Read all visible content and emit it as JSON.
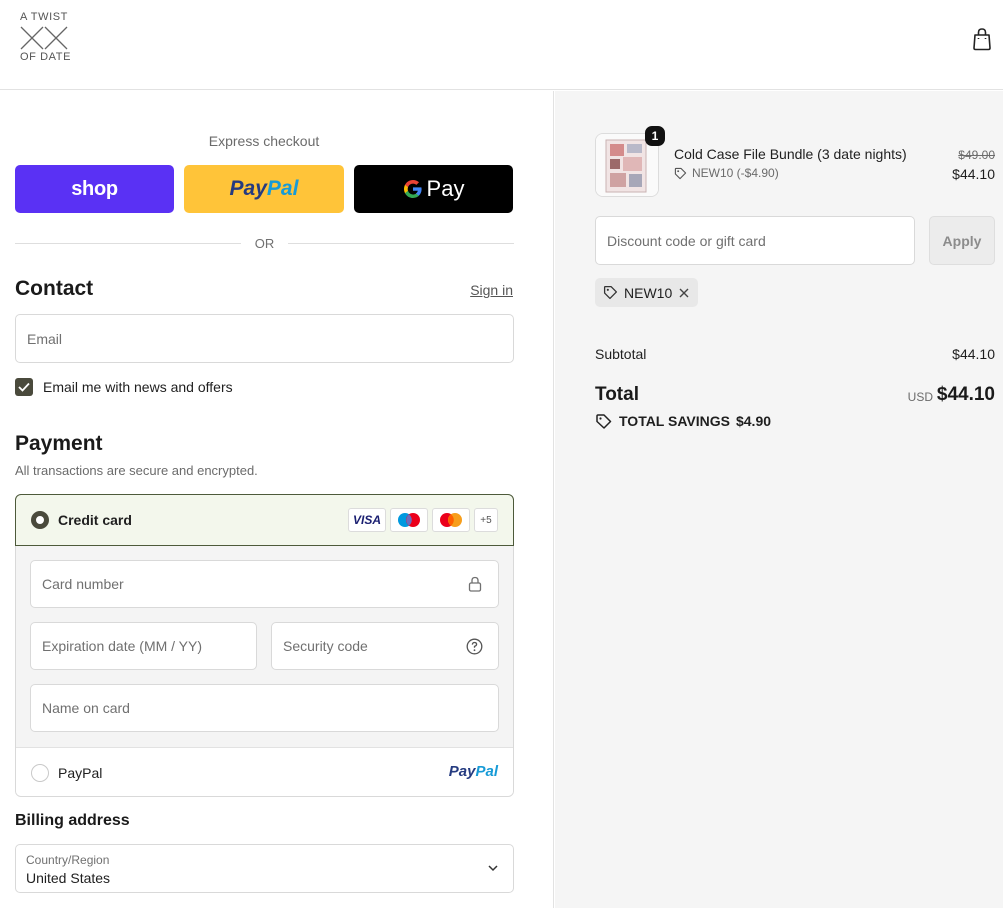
{
  "header": {
    "logo_top": "A TWIST",
    "logo_bottom": "OF DATE",
    "cart_icon": "shopping-bag-icon"
  },
  "express": {
    "label": "Express checkout",
    "shop_label": "shop",
    "paypal_part1": "Pay",
    "paypal_part2": "Pal",
    "gpay_label": "Pay",
    "or_label": "OR"
  },
  "contact": {
    "title": "Contact",
    "sign_in": "Sign in",
    "email_placeholder": "Email",
    "news_checkbox_label": "Email me with news and offers",
    "news_checked": true
  },
  "payment": {
    "title": "Payment",
    "subtitle": "All transactions are secure and encrypted.",
    "credit_card_label": "Credit card",
    "card_brands": [
      "VISA",
      "maestro",
      "mastercard"
    ],
    "more_cards": "+5",
    "card_number_placeholder": "Card number",
    "expiration_placeholder": "Expiration date (MM / YY)",
    "security_code_placeholder": "Security code",
    "name_on_card_placeholder": "Name on card",
    "paypal_label": "PayPal",
    "paypal_logo_part1": "Pay",
    "paypal_logo_part2": "Pal"
  },
  "billing": {
    "title": "Billing address",
    "country_label": "Country/Region",
    "country_value": "United States"
  },
  "summary": {
    "product_name": "Cold Case File Bundle (3 date nights)",
    "product_quantity": "1",
    "product_discount": "NEW10 (-$4.90)",
    "price_original": "$49.00",
    "price_final": "$44.10",
    "discount_placeholder": "Discount code or gift card",
    "apply_label": "Apply",
    "applied_code": "NEW10",
    "subtotal_label": "Subtotal",
    "subtotal_value": "$44.10",
    "total_label": "Total",
    "currency": "USD",
    "total_value": "$44.10",
    "savings_label": "TOTAL SAVINGS",
    "savings_value": "$4.90"
  },
  "colors": {
    "shop_purple": "#5a31f4",
    "paypal_yellow": "#ffc439",
    "accent_olive": "#4a4a3c",
    "summary_bg": "#f5f5f5"
  }
}
